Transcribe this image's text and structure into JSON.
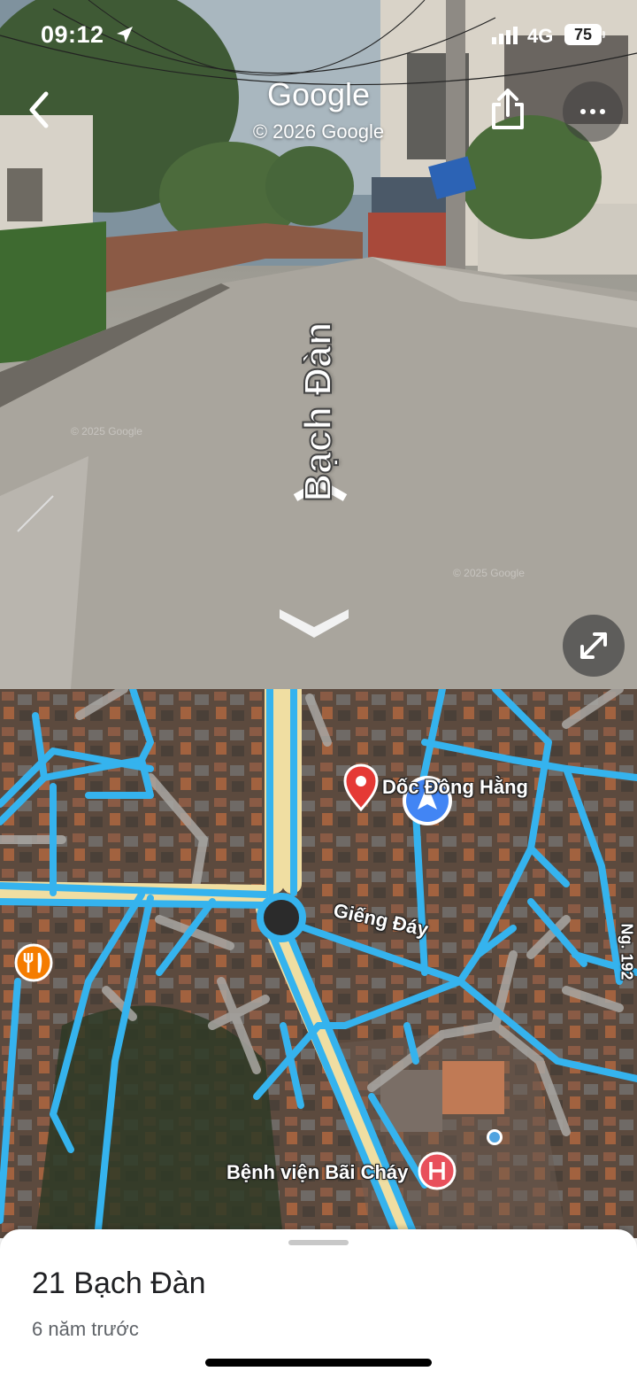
{
  "status_bar": {
    "time": "09:12",
    "network": "4G",
    "battery": "75"
  },
  "street_view": {
    "title": "Google",
    "copyright": "© 2026 Google",
    "street_name": "Bạch Đàn",
    "sign_text": "BẠCH ĐÀN",
    "watermark": "© 2025 Google"
  },
  "map": {
    "labels": {
      "poi": "Dốc Đông Hằng",
      "street": "Giếng Đáy",
      "hospital": "Bệnh viện Bãi Cháy",
      "edge_street": "Ng. 192"
    },
    "colors": {
      "road": "#35b3ee",
      "poi_pin": "#e53935",
      "hospital": "#e8505b",
      "restaurant": "#f57c00",
      "location": "#4285f4"
    }
  },
  "place": {
    "title": "21 Bạch Đàn",
    "subtitle": "6 năm trước"
  },
  "icons": [
    "location-arrow-icon",
    "back-icon",
    "share-icon",
    "more-icon",
    "expand-icon",
    "chevron-up-icon",
    "chevron-down-icon",
    "pin-icon",
    "location-arrow-marker",
    "restaurant-icon",
    "hospital-icon"
  ]
}
